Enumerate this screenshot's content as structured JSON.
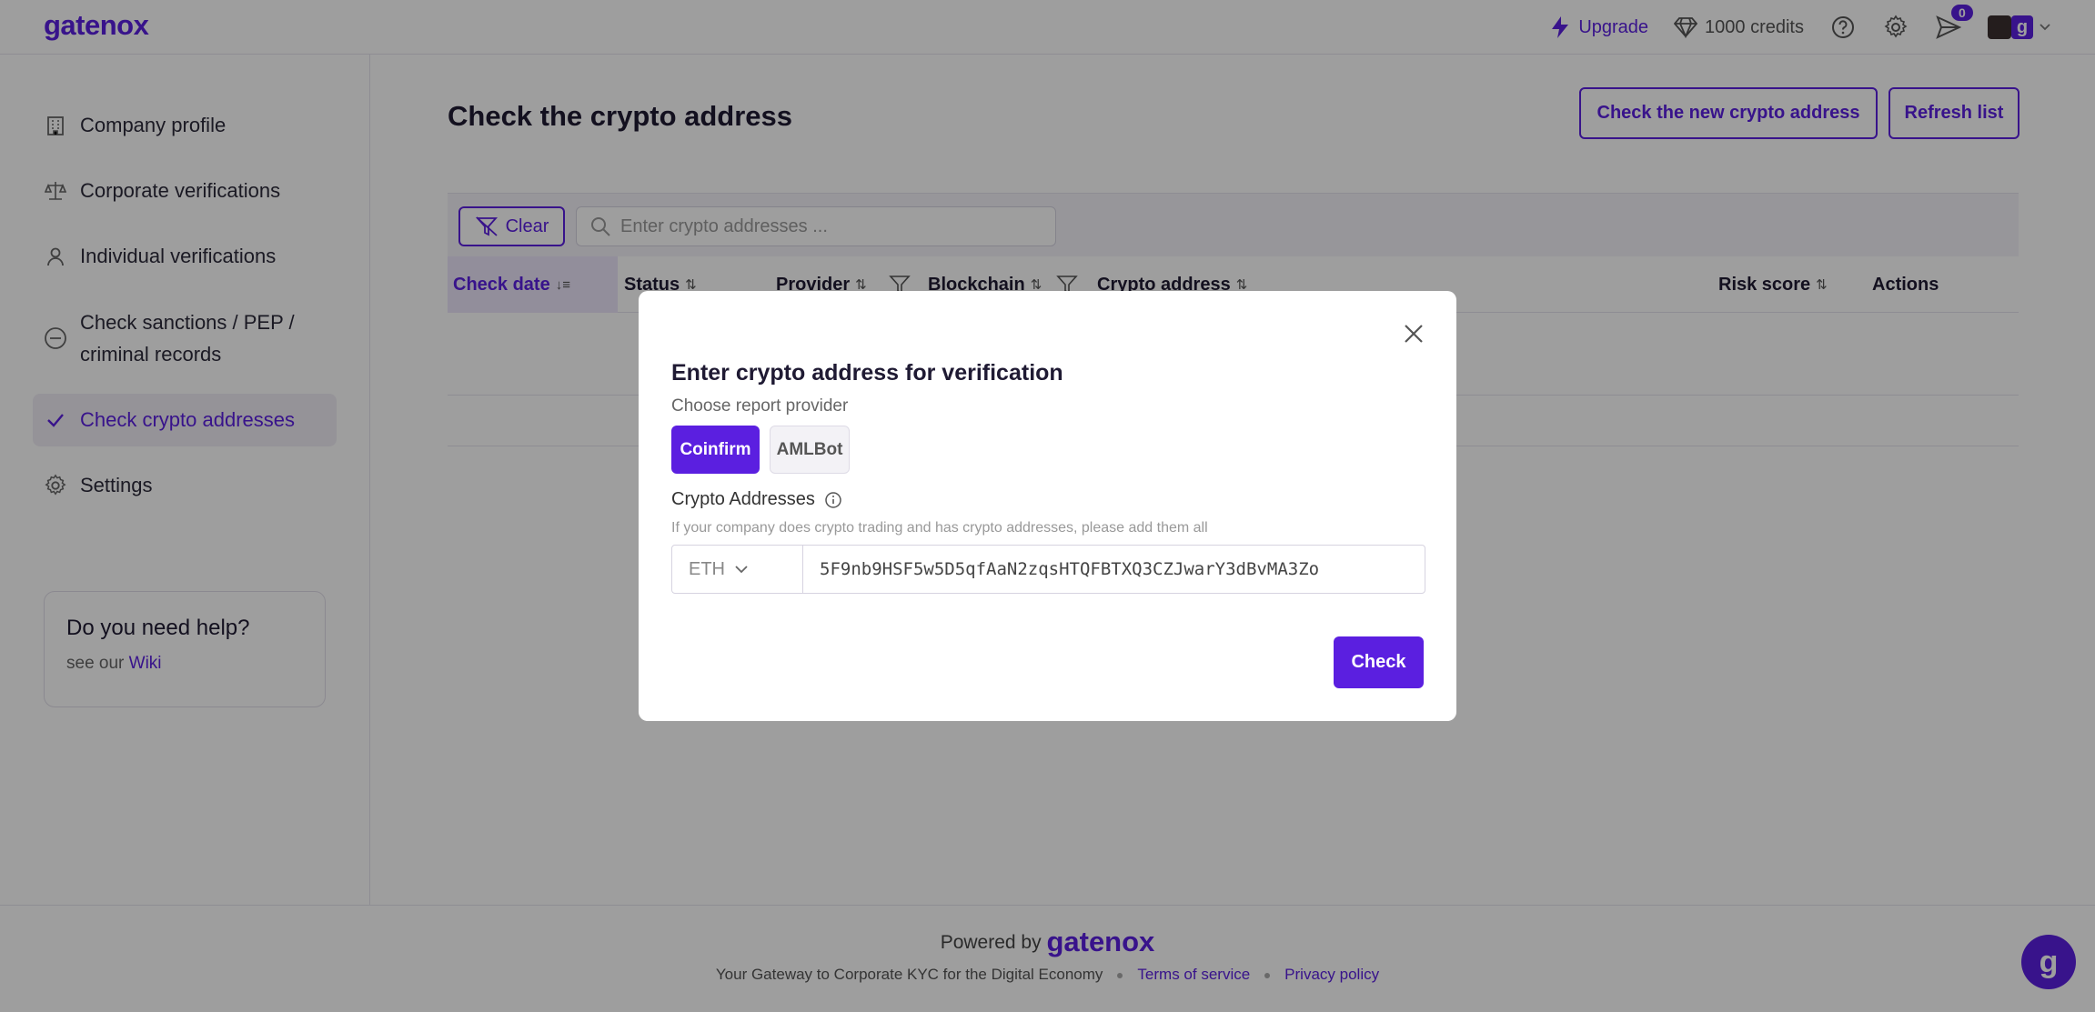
{
  "header": {
    "logo": "gatenox",
    "upgrade_label": "Upgrade",
    "credits_label": "1000 credits",
    "notifications_count": "0",
    "avatar_letter": "g"
  },
  "sidebar": {
    "items": [
      {
        "label": "Company profile",
        "icon": "building-icon"
      },
      {
        "label": "Corporate verifications",
        "icon": "scales-icon"
      },
      {
        "label": "Individual verifications",
        "icon": "user-icon"
      },
      {
        "label": "Check sanctions / PEP / criminal records",
        "icon": "minus-circle-icon"
      },
      {
        "label": "Check crypto addresses",
        "icon": "check-icon",
        "active": true
      },
      {
        "label": "Settings",
        "icon": "gear-icon"
      }
    ],
    "help": {
      "title": "Do you need help?",
      "prefix": "see our ",
      "link": "Wiki"
    }
  },
  "main": {
    "title": "Check the crypto address",
    "new_check_button": "Check the new crypto address",
    "refresh_button": "Refresh list",
    "clear_button": "Clear",
    "search_placeholder": "Enter crypto addresses ...",
    "columns": [
      "Check date",
      "Status",
      "Provider",
      "Blockchain",
      "Crypto address",
      "Risk score",
      "Actions"
    ]
  },
  "modal": {
    "title": "Enter crypto address for verification",
    "provider_prompt": "Choose report provider",
    "providers": [
      "Coinfirm",
      "AMLBot"
    ],
    "selected_provider": "Coinfirm",
    "field_label": "Crypto Addresses",
    "hint": "If your company does crypto trading and has crypto addresses, please add them all",
    "chain": "ETH",
    "address_value": "5F9nb9HSF5w5D5qfAaN2zqsHTQFBTXQ3CZJwarY3dBvMA3Zo",
    "check_button": "Check"
  },
  "footer": {
    "powered_prefix": "Powered by",
    "powered_brand": "gatenox",
    "tagline": "Your Gateway to Corporate KYC for the Digital Economy",
    "terms": "Terms of service",
    "privacy": "Privacy policy"
  },
  "colors": {
    "brand": "#5b1fe0",
    "overlay": "rgba(0,0,0,0.38)"
  }
}
